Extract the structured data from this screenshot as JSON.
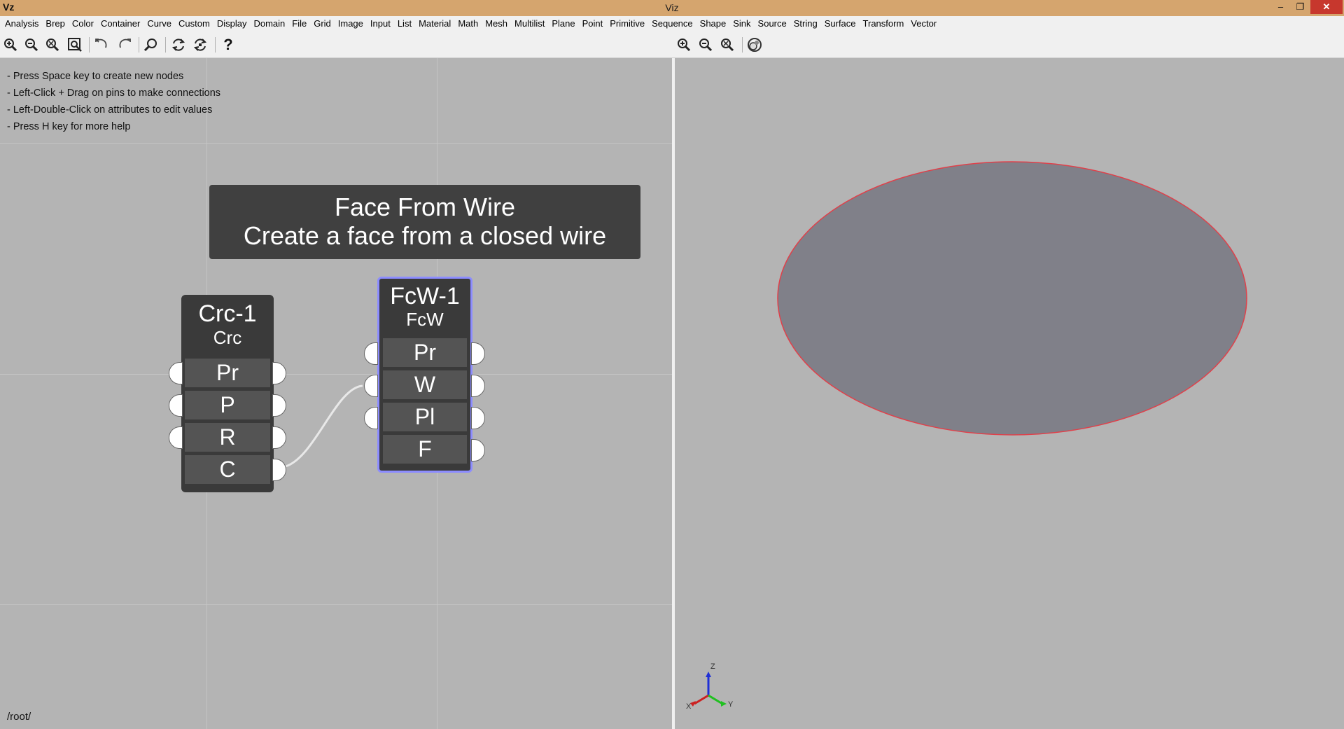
{
  "window": {
    "title": "Viz",
    "app_icon": "Vz",
    "min_glyph": "–",
    "max_glyph": "❐",
    "close_glyph": "✕"
  },
  "menu": [
    "Analysis",
    "Brep",
    "Color",
    "Container",
    "Curve",
    "Custom",
    "Display",
    "Domain",
    "File",
    "Grid",
    "Image",
    "Input",
    "List",
    "Material",
    "Math",
    "Mesh",
    "Multilist",
    "Plane",
    "Point",
    "Primitive",
    "Sequence",
    "Shape",
    "Sink",
    "Source",
    "String",
    "Surface",
    "Transform",
    "Vector"
  ],
  "toolbar": {
    "help_glyph": "?",
    "left_icons": [
      "zoom-in-icon",
      "zoom-out-icon",
      "zoom-reset-icon",
      "zoom-fit-icon",
      "undo-icon",
      "redo-icon",
      "find-icon",
      "refresh-icon",
      "refresh-all-icon",
      "help-icon"
    ],
    "viewport_icons": [
      "zoom-in-icon",
      "zoom-out-icon",
      "zoom-reset-icon",
      "render-icon"
    ]
  },
  "help": {
    "line1": "- Press Space key to create new nodes",
    "line2": "- Left-Click + Drag on pins to make connections",
    "line3": "- Left-Double-Click on attributes to edit values",
    "line4": "- Press H key for more help"
  },
  "tooltip": {
    "title": "Face From Wire",
    "description": "Create a face from a closed wire"
  },
  "nodes": {
    "crc": {
      "name": "Crc-1",
      "type": "Crc",
      "attrs": [
        "Pr",
        "P",
        "R",
        "C"
      ]
    },
    "fcw": {
      "name": "FcW-1",
      "type": "FcW",
      "attrs": [
        "Pr",
        "W",
        "Pl",
        "F"
      ],
      "selected": true
    }
  },
  "connection": {
    "from": "Crc-1.C",
    "to": "FcW-1.W"
  },
  "path": "/root/",
  "viewport": {
    "face_color": "#808089",
    "edge_color": "#e0404a",
    "background": "#b4b4b4",
    "axes": {
      "x": "X",
      "y": "Y",
      "z": "Z"
    }
  }
}
